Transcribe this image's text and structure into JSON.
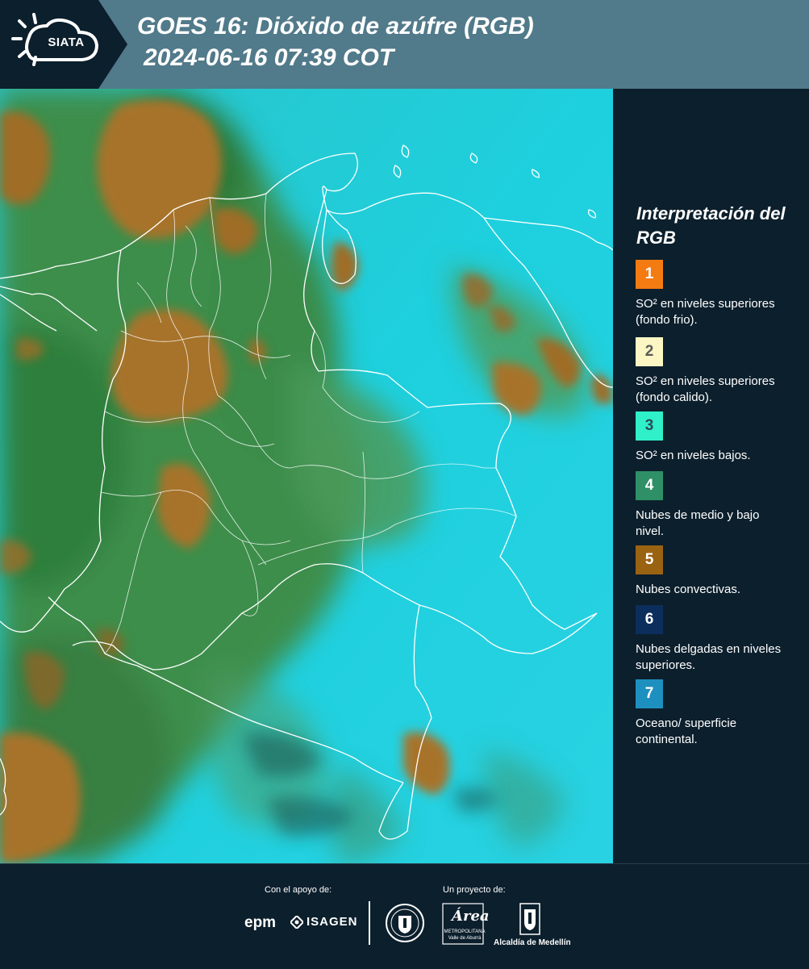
{
  "header": {
    "logo_text": "SIATA",
    "title_line1": "GOES 16: Dióxido de azúfre (RGB)",
    "title_line2": "2024-06-16 07:39 COT",
    "background_color": "#517a8a"
  },
  "legend": {
    "title": "Interpretación del RGB",
    "items": [
      {
        "number": "1",
        "color": "#f47b12",
        "text_color": "#ffffff",
        "label": "SO² en niveles superiores (fondo frio)."
      },
      {
        "number": "2",
        "color": "#fbf6c4",
        "text_color": "#5a5a5a",
        "label": "SO² en niveles superiores (fondo calido)."
      },
      {
        "number": "3",
        "color": "#2ff0c8",
        "text_color": "#2b4a55",
        "label": "SO² en niveles bajos."
      },
      {
        "number": "4",
        "color": "#2f8f67",
        "text_color": "#ffffff",
        "label": "Nubes de medio y bajo nivel."
      },
      {
        "number": "5",
        "color": "#9a6312",
        "text_color": "#ffffff",
        "label": "Nubes convectivas."
      },
      {
        "number": "6",
        "color": "#0c2e5c",
        "text_color": "#ffffff",
        "label": "Nubes delgadas en niveles superiores."
      },
      {
        "number": "7",
        "color": "#1e90bf",
        "text_color": "#ffffff",
        "label": "Oceano/ superficie continental."
      }
    ]
  },
  "footer": {
    "support_caption": "Con el apoyo de:",
    "project_caption": "Un proyecto de:",
    "epm_text": "epm",
    "isagen_text": "ISAGEN",
    "area_script": "Área",
    "area_sub1": "METROPOLITANA",
    "area_sub2": "Valle de Aburrá",
    "alcaldia_text": "Alcaldía de Medellín"
  },
  "map": {
    "colors": {
      "ocean_cyan": "#1fc7d6",
      "low_cloud_green": "#3a8f4c",
      "convective_brown": "#a7732a",
      "border_white": "#ffffff"
    }
  }
}
